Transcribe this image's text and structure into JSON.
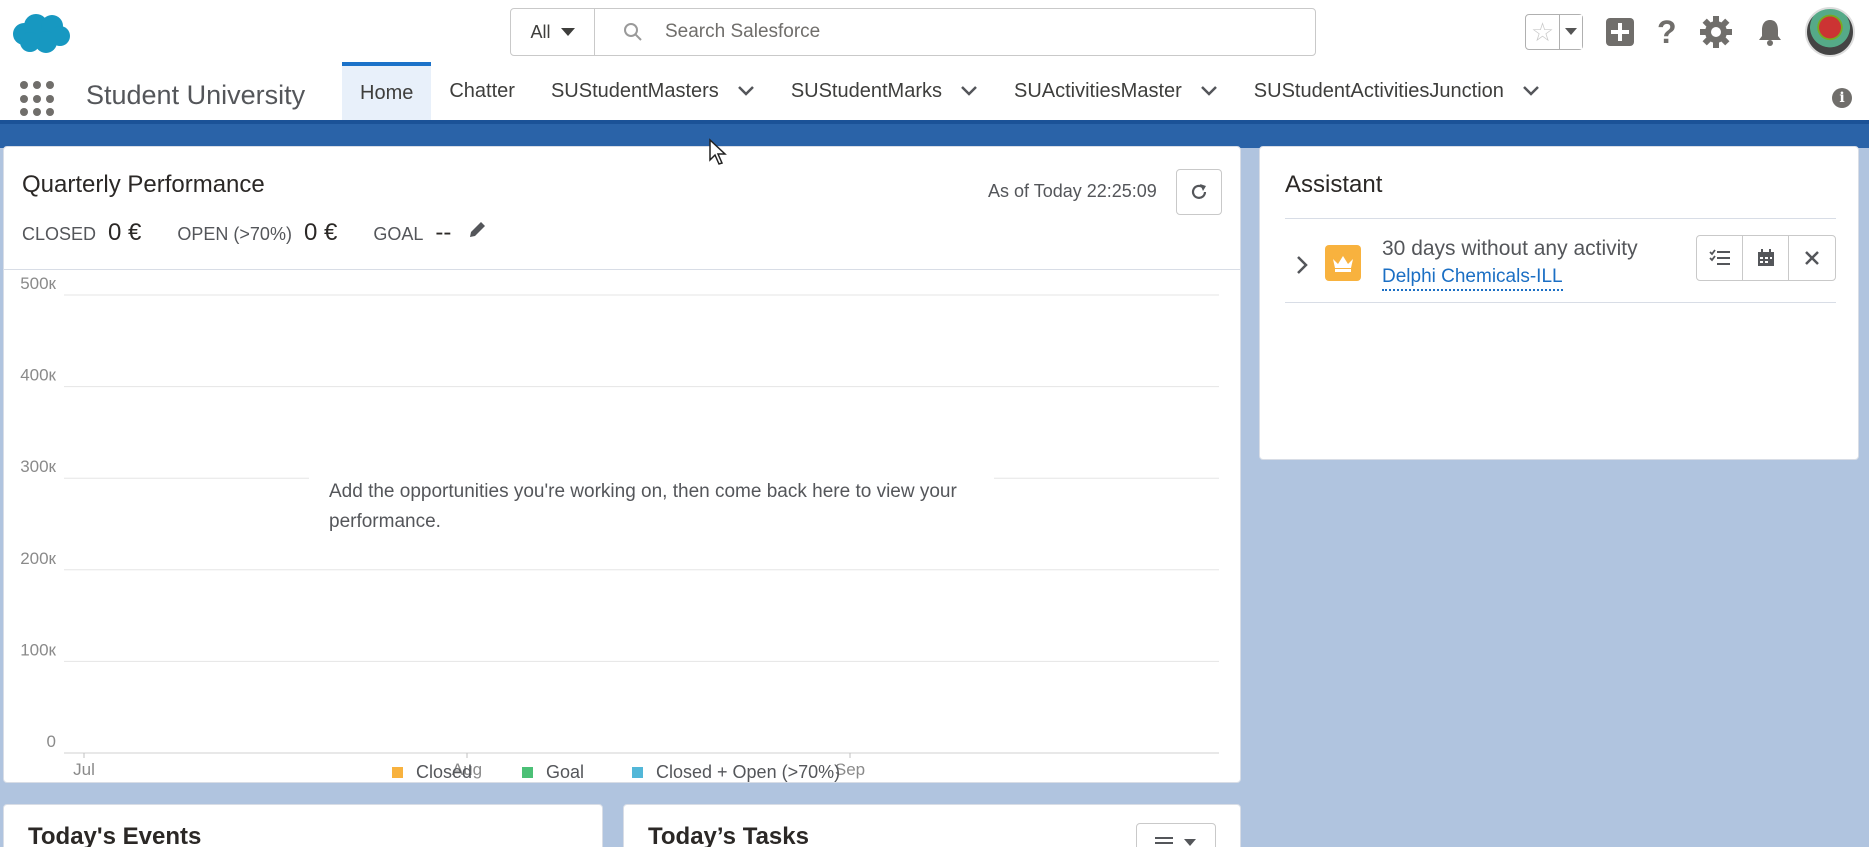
{
  "header": {
    "logo_icon": "salesforce-cloud-icon",
    "brand_color": "#1798c1",
    "search": {
      "scope": "All",
      "placeholder": "Search Salesforce"
    },
    "icons": [
      "star-icon",
      "chevron-down-icon",
      "add-icon",
      "help-icon",
      "gear-icon",
      "bell-icon"
    ]
  },
  "nav": {
    "app_name": "Student University",
    "tabs": [
      {
        "label": "Home",
        "active": true,
        "has_menu": false
      },
      {
        "label": "Chatter",
        "active": false,
        "has_menu": false
      },
      {
        "label": "SUStudentMasters",
        "active": false,
        "has_menu": true
      },
      {
        "label": "SUStudentMarks",
        "active": false,
        "has_menu": true
      },
      {
        "label": "SUActivitiesMaster",
        "active": false,
        "has_menu": true
      },
      {
        "label": "SUStudentActivitiesJunction",
        "active": false,
        "has_menu": true
      }
    ]
  },
  "performance": {
    "title": "Quarterly Performance",
    "as_of": "As of Today 22:25:09",
    "closed_label": "CLOSED",
    "closed_value": "0 €",
    "open_label": "OPEN (>70%)",
    "open_value": "0 €",
    "goal_label": "GOAL",
    "goal_value": "--",
    "empty_message": "Add the opportunities you're working on, then come back here to view your performance."
  },
  "chart_data": {
    "type": "line",
    "title": "",
    "xlabel": "",
    "ylabel": "",
    "categories": [
      "Jul",
      "Aug",
      "Sep"
    ],
    "y_ticks": [
      "0",
      "100к",
      "200к",
      "300к",
      "400к",
      "500к"
    ],
    "ylim": [
      0,
      500000
    ],
    "grid": true,
    "legend_position": "bottom",
    "series": [
      {
        "name": "Closed",
        "color": "#f8b23e",
        "values": []
      },
      {
        "name": "Goal",
        "color": "#4bc076",
        "values": []
      },
      {
        "name": "Closed + Open (>70%)",
        "color": "#52b7d8",
        "values": []
      }
    ]
  },
  "assistant": {
    "title": "Assistant",
    "item": {
      "text": "30 days without any activity",
      "link": "Delphi Chemicals-ILL",
      "icon": "crown-icon",
      "icon_color": "#f8b23e",
      "actions": [
        "new-task-icon",
        "calendar-icon",
        "close-icon"
      ]
    }
  },
  "events": {
    "title": "Today's Events"
  },
  "tasks": {
    "title": "Today’s Tasks"
  }
}
